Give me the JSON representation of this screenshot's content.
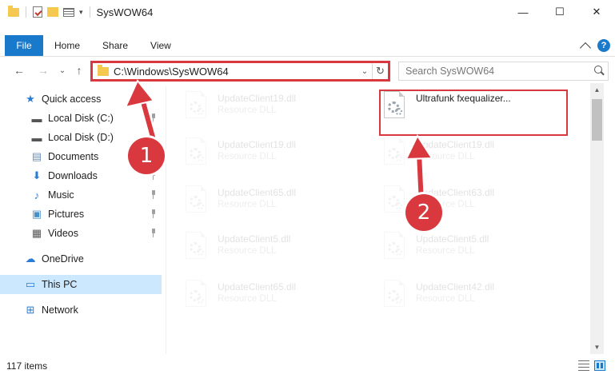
{
  "window": {
    "title": "SysWOW64",
    "min_glyph": "—",
    "max_glyph": "☐",
    "close_glyph": "✕"
  },
  "ribbon": {
    "tabs": [
      "File",
      "Home",
      "Share",
      "View"
    ],
    "help_glyph": "?"
  },
  "nav": {
    "back_glyph": "←",
    "forward_glyph": "→",
    "recent_glyph": "⌄",
    "up_glyph": "↑",
    "address": "C:\\Windows\\SysWOW64",
    "address_dropdown_glyph": "⌄",
    "refresh_glyph": "↻",
    "search_placeholder": "Search SysWOW64"
  },
  "sidebar": {
    "items": [
      {
        "label": "Quick access",
        "icon": "star-icon",
        "glyph": "★",
        "color": "#2a7cd3",
        "pinned": false
      },
      {
        "label": "Local Disk (C:)",
        "icon": "drive-icon",
        "glyph": "▬",
        "color": "#555555",
        "pinned": true
      },
      {
        "label": "Local Disk (D:)",
        "icon": "drive-icon",
        "glyph": "▬",
        "color": "#555555",
        "pinned": true
      },
      {
        "label": "Documents",
        "icon": "documents-icon",
        "glyph": "▤",
        "color": "#6b8fb5",
        "pinned": true
      },
      {
        "label": "Downloads",
        "icon": "downloads-icon",
        "glyph": "⬇",
        "color": "#2a7cd3",
        "pinned": true
      },
      {
        "label": "Music",
        "icon": "music-icon",
        "glyph": "♪",
        "color": "#2a7cd3",
        "pinned": true
      },
      {
        "label": "Pictures",
        "icon": "pictures-icon",
        "glyph": "▣",
        "color": "#4a90c8",
        "pinned": true
      },
      {
        "label": "Videos",
        "icon": "videos-icon",
        "glyph": "▦",
        "color": "#555555",
        "pinned": true
      },
      {
        "label": "OneDrive",
        "icon": "onedrive-icon",
        "glyph": "☁",
        "color": "#2a7cd3",
        "pinned": false
      },
      {
        "label": "This PC",
        "icon": "computer-icon",
        "glyph": "▭",
        "color": "#2a7cd3",
        "pinned": false,
        "selected": true
      },
      {
        "label": "Network",
        "icon": "network-icon",
        "glyph": "⊞",
        "color": "#2a7cd3",
        "pinned": false
      }
    ]
  },
  "files": [
    {
      "name": "UpdateClient19.dll",
      "type": "Resource DLL",
      "faded": true
    },
    {
      "name": "Ultrafunk fxequalizer...",
      "type": "",
      "faded": false
    },
    {
      "name": "UpdateClient19.dll",
      "type": "Resource DLL",
      "faded": true
    },
    {
      "name": "UpdateClient19.dll",
      "type": "Resource DLL",
      "faded": true
    },
    {
      "name": "UpdateClient65.dll",
      "type": "Resource DLL",
      "faded": true
    },
    {
      "name": "UpdateClient63.dll",
      "type": "Resource DLL",
      "faded": true
    },
    {
      "name": "UpdateClient5.dll",
      "type": "Resource DLL",
      "faded": true
    },
    {
      "name": "UpdateClient5.dll",
      "type": "Resource DLL",
      "faded": true
    },
    {
      "name": "UpdateClient65.dll",
      "type": "Resource DLL",
      "faded": true
    },
    {
      "name": "UpdateClient42.dll",
      "type": "Resource DLL",
      "faded": true
    }
  ],
  "status": {
    "item_count": "117 items"
  },
  "callouts": [
    {
      "number": "1"
    },
    {
      "number": "2"
    }
  ],
  "colors": {
    "accent": "#1979ca",
    "highlight": "#d9393e",
    "selection": "#cce8ff"
  }
}
